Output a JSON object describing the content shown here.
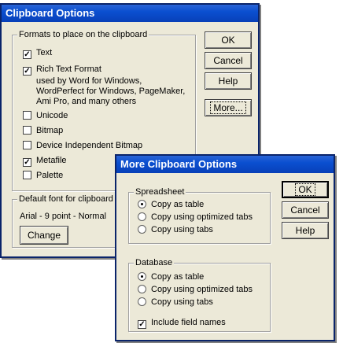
{
  "main_dialog": {
    "title": "Clipboard Options",
    "formats_group": {
      "legend": "Formats to place on the clipboard",
      "items": [
        {
          "label": "Text",
          "checked": true
        },
        {
          "label": "Rich Text Format",
          "checked": true
        },
        {
          "label": "Unicode",
          "checked": false
        },
        {
          "label": "Bitmap",
          "checked": false
        },
        {
          "label": "Device Independent Bitmap",
          "checked": false
        },
        {
          "label": "Metafile",
          "checked": true
        },
        {
          "label": "Palette",
          "checked": false
        }
      ],
      "rtf_description": [
        "used by Word for Windows,",
        "WordPerfect for Windows, PageMaker,",
        "Ami Pro, and many others"
      ]
    },
    "font_group": {
      "legend": "Default font for clipboard",
      "value": "Arial - 9 point - Normal",
      "change_label": "Change"
    },
    "buttons": {
      "ok": "OK",
      "cancel": "Cancel",
      "help": "Help",
      "more": "More..."
    }
  },
  "more_dialog": {
    "title": "More Clipboard Options",
    "spreadsheet_group": {
      "legend": "Spreadsheet",
      "options": [
        "Copy as table",
        "Copy using optimized tabs",
        "Copy using tabs"
      ],
      "selected": 0
    },
    "database_group": {
      "legend": "Database",
      "options": [
        "Copy as table",
        "Copy using optimized tabs",
        "Copy using tabs"
      ],
      "selected": 0,
      "include_field_names_label": "Include field names",
      "include_field_names_checked": true
    },
    "buttons": {
      "ok": "OK",
      "cancel": "Cancel",
      "help": "Help"
    }
  }
}
